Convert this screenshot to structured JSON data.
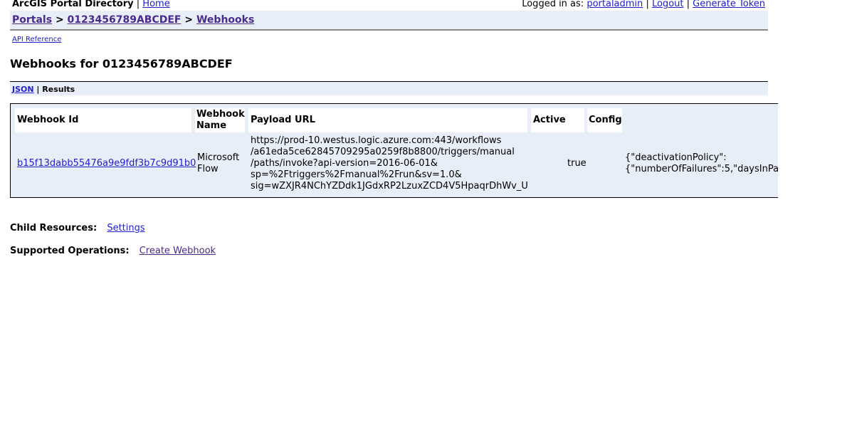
{
  "header": {
    "app_title": "ArcGIS Portal Directory",
    "home_link": "Home",
    "logged_in_label": "Logged in as:",
    "username": "portaladmin",
    "logout_link": "Logout",
    "generate_token_link": "Generate Token",
    "separator": "|"
  },
  "breadcrumb": {
    "items": [
      "Portals",
      "0123456789ABCDEF",
      "Webhooks"
    ],
    "separator": ">"
  },
  "api_reference_link": "API Reference",
  "page_title": "Webhooks for 0123456789ABCDEF",
  "format": {
    "json_link": "JSON",
    "separator": "|",
    "current": "Results"
  },
  "table": {
    "headers": {
      "id": "Webhook Id",
      "name_line1": "Webhook",
      "name_line2": "Name",
      "url": "Payload URL",
      "active": "Active",
      "config": "Config"
    },
    "rows": [
      {
        "id": "b15f13dabb55476a9e9fdf3b7c9d91b0",
        "name_line1": "Microsoft",
        "name_line2": "Flow",
        "url_lines": [
          "https://prod-10.westus.logic.azure.com:443/workflows",
          "/a61eda5ce62845709295a0259f8b8800/triggers/manual",
          "/paths/invoke?api-version=2016-06-01&",
          "sp=%2Ftriggers%2Fmanual%2Frun&sv=1.0&",
          "sig=wZXJR4NChYZDdk1JGdxRP2LzuxZCD4V5HpaqrDhWv_U"
        ],
        "active": "true",
        "config_line1": "{\"deactivationPolicy\":",
        "config_line2": "{\"numberOfFailures\":5,\"daysInPa"
      }
    ]
  },
  "child_resources": {
    "label": "Child Resources:",
    "links": [
      "Settings"
    ]
  },
  "supported_operations": {
    "label": "Supported Operations:",
    "links": [
      "Create Webhook"
    ]
  }
}
